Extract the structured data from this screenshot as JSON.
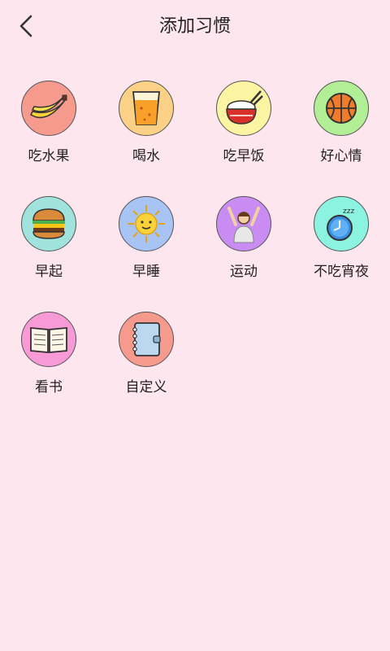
{
  "header": {
    "title": "添加习惯"
  },
  "habits": [
    {
      "label": "吃水果",
      "icon": "banana-icon",
      "bg": "#f59a8c"
    },
    {
      "label": "喝水",
      "icon": "water-glass-icon",
      "bg": "#fbd087"
    },
    {
      "label": "吃早饭",
      "icon": "rice-bowl-icon",
      "bg": "#fbf4a2"
    },
    {
      "label": "好心情",
      "icon": "basketball-icon",
      "bg": "#b2ee95"
    },
    {
      "label": "早起",
      "icon": "burger-icon",
      "bg": "#9fe3dc"
    },
    {
      "label": "早睡",
      "icon": "sun-icon",
      "bg": "#a7c4f5"
    },
    {
      "label": "运动",
      "icon": "stretching-person-icon",
      "bg": "#c98cf2"
    },
    {
      "label": "不吃宵夜",
      "icon": "sleep-clock-icon",
      "bg": "#8bf3e0"
    },
    {
      "label": "看书",
      "icon": "open-book-icon",
      "bg": "#f79ad6"
    },
    {
      "label": "自定义",
      "icon": "notebook-icon",
      "bg": "#f59a8c"
    }
  ]
}
